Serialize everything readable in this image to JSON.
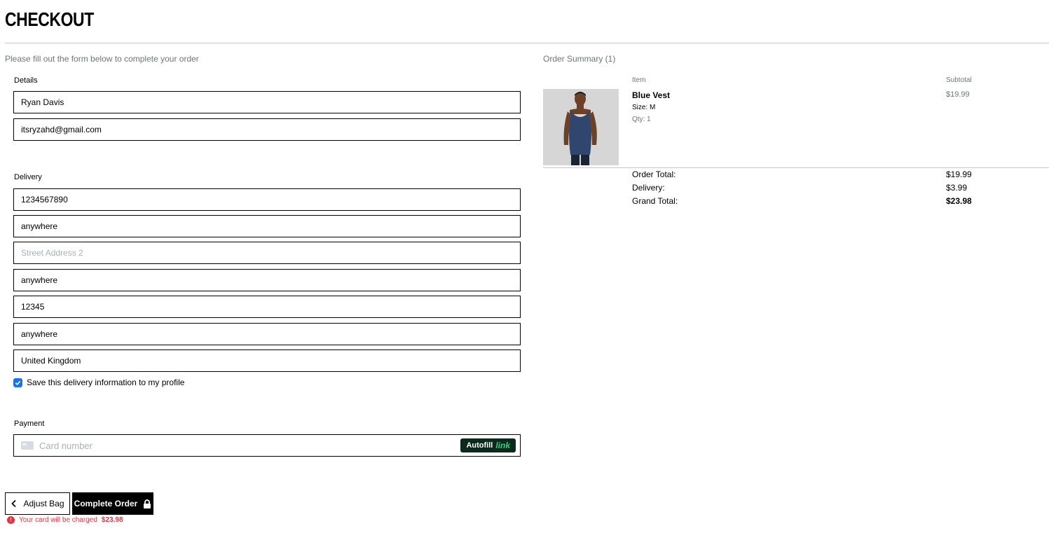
{
  "page": {
    "title": "CHECKOUT",
    "intro": "Please fill out the form below to complete your order"
  },
  "details": {
    "label": "Details",
    "full_name": "Ryan Davis",
    "email": "itsryzahd@gmail.com"
  },
  "delivery": {
    "label": "Delivery",
    "phone": "1234567890",
    "street1": "anywhere",
    "street2_placeholder": "Street Address 2",
    "town": "anywhere",
    "postcode": "12345",
    "county": "anywhere",
    "country": "United Kingdom",
    "save_label": "Save this delivery information to my profile",
    "save_checked": true
  },
  "payment": {
    "label": "Payment",
    "card_placeholder": "Card number",
    "autofill_label": "Autofill",
    "autofill_link": "link"
  },
  "actions": {
    "adjust_label": "Adjust Bag",
    "complete_label": "Complete Order",
    "charge_text": "Your card will be charged",
    "charge_amount": "$23.98"
  },
  "summary": {
    "title": "Order Summary (1)",
    "col_item": "Item",
    "col_subtotal": "Subtotal",
    "items": [
      {
        "name": "Blue Vest",
        "size": "Size: M",
        "qty": "Qty: 1",
        "subtotal": "$19.99"
      }
    ],
    "order_total_label": "Order Total:",
    "order_total": "$19.99",
    "delivery_label": "Delivery:",
    "delivery": "$3.99",
    "grand_total_label": "Grand Total:",
    "grand_total": "$23.98"
  },
  "colors": {
    "accent": "#000000",
    "error": "#dc3545",
    "checkbox": "#1a73e8",
    "muted": "#6c757d"
  }
}
